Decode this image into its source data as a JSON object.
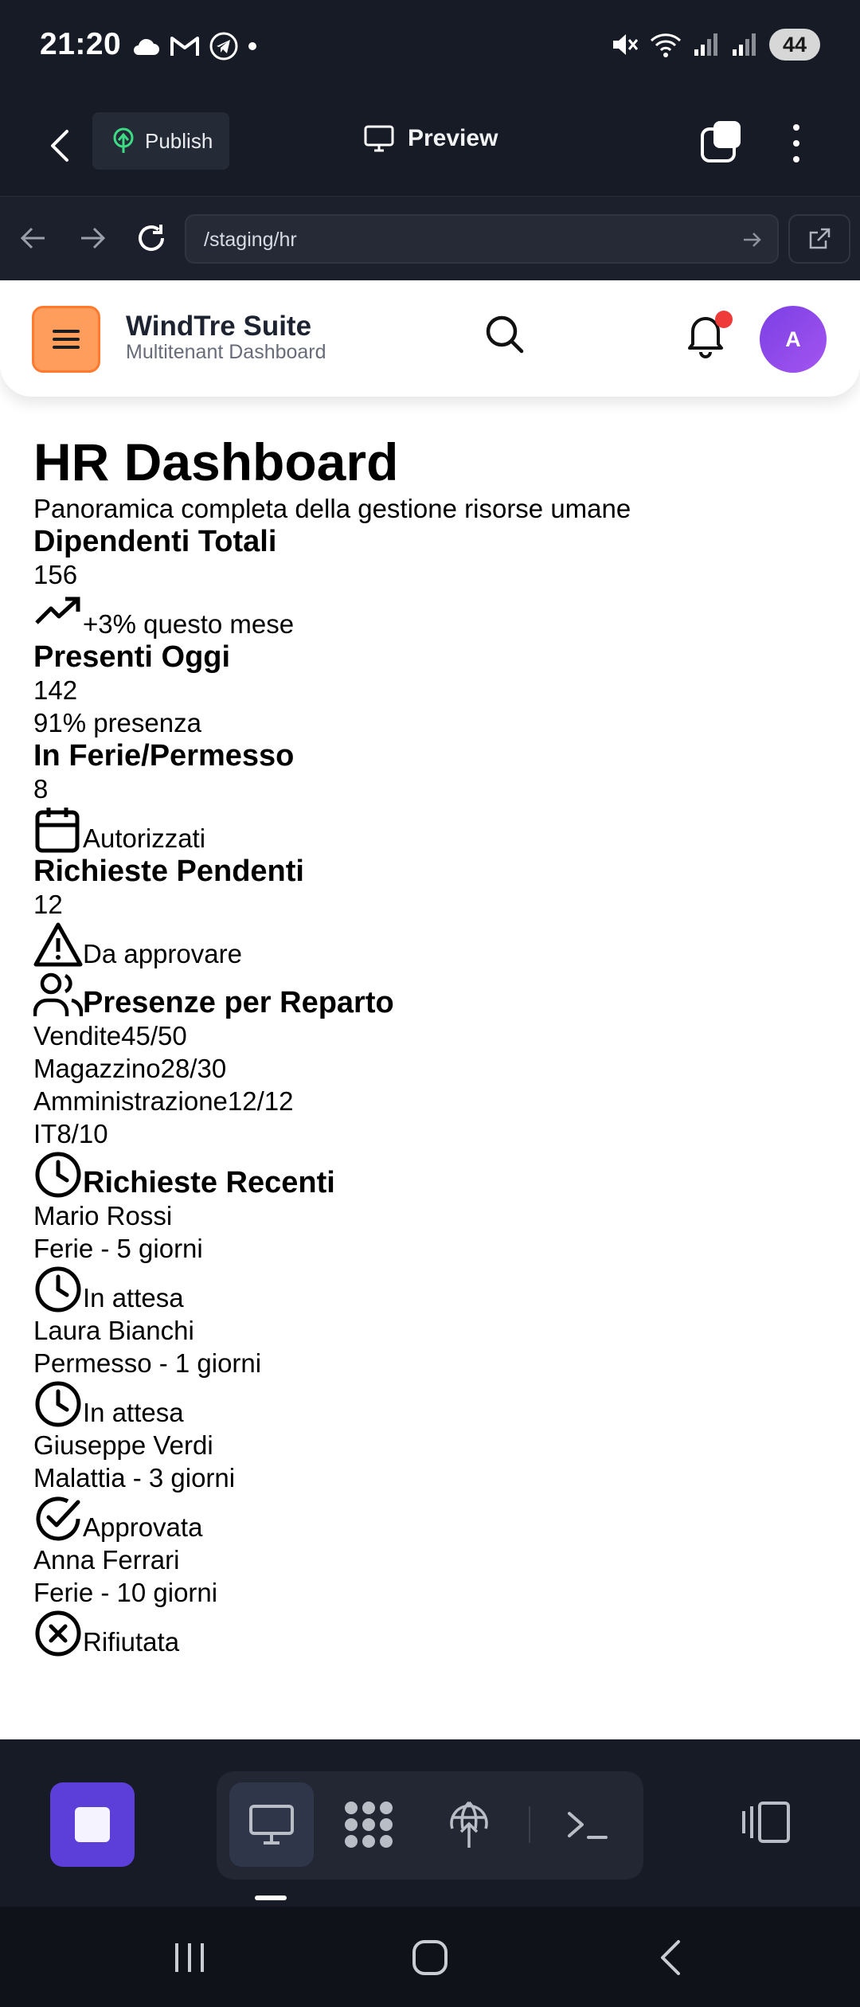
{
  "status_bar": {
    "time": "21:20",
    "battery": "44"
  },
  "editor": {
    "publish_label": "Publish",
    "preview_label": "Preview"
  },
  "url_bar": {
    "url": "/staging/hr"
  },
  "app": {
    "brand_title": "WindTre Suite",
    "brand_subtitle": "Multitenant Dashboard",
    "avatar_initial": "A",
    "accent": "#ff9d5c",
    "notification_dot_color": "#ef3a3a"
  },
  "page": {
    "title": "HR Dashboard",
    "subtitle": "Panoramica completa della gestione risorse umane",
    "stats": [
      {
        "label": "Dipendenti Totali",
        "value": "156",
        "note": "+3% questo mese",
        "icon": "trending-up-icon"
      },
      {
        "label": "Presenti Oggi",
        "value": "142",
        "note": "91% presenza",
        "icon": ""
      },
      {
        "label": "In Ferie/Permesso",
        "value": "8",
        "note": "Autorizzati",
        "icon": "calendar-icon"
      },
      {
        "label": "Richieste Pendenti",
        "value": "12",
        "note": "Da approvare",
        "icon": "alert-triangle-icon"
      }
    ],
    "attendance": {
      "title": "Presenze per Reparto",
      "icon": "users-icon",
      "departments": [
        {
          "name": "Vendite",
          "value": "45/50"
        },
        {
          "name": "Magazzino",
          "value": "28/30"
        },
        {
          "name": "Amministrazione",
          "value": "12/12"
        },
        {
          "name": "IT",
          "value": "8/10"
        }
      ]
    },
    "requests": {
      "title": "Richieste Recenti",
      "icon": "clock-icon",
      "items": [
        {
          "name": "Mario Rossi",
          "detail": "Ferie - 5 giorni",
          "status": "In attesa",
          "icon": "clock-icon"
        },
        {
          "name": "Laura Bianchi",
          "detail": "Permesso - 1 giorni",
          "status": "In attesa",
          "icon": "clock-icon"
        },
        {
          "name": "Giuseppe Verdi",
          "detail": "Malattia - 3 giorni",
          "status": "Approvata",
          "icon": "check-circle-icon"
        },
        {
          "name": "Anna Ferrari",
          "detail": "Ferie - 10 giorni",
          "status": "Rifiutata",
          "icon": "x-circle-icon"
        }
      ]
    }
  },
  "dock": {
    "stop_color": "#5b3fd8"
  }
}
